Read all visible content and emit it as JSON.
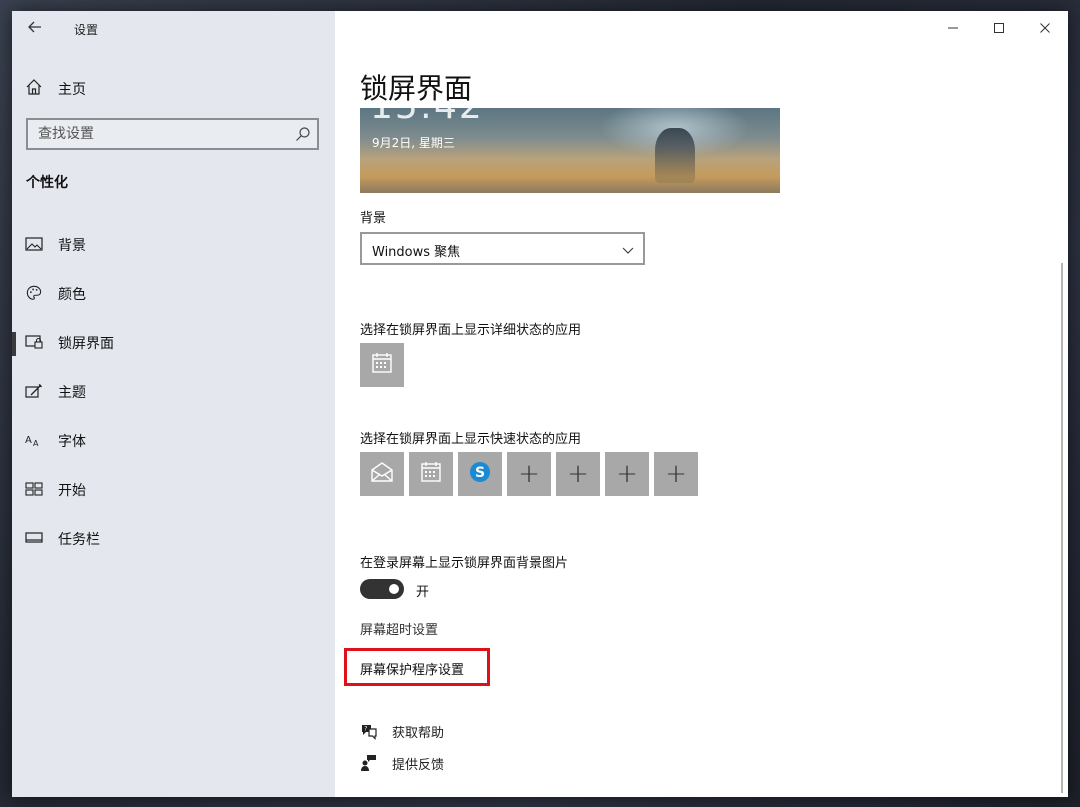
{
  "window": {
    "app_title": "设置",
    "back_icon": "arrow-left-icon",
    "controls": {
      "minimize": "—",
      "maximize": "☐",
      "close": "✕"
    }
  },
  "sidebar": {
    "home_label": "主页",
    "search_placeholder": "查找设置",
    "section_title": "个性化",
    "items": [
      {
        "label": "背景",
        "icon": "picture-icon",
        "active": false
      },
      {
        "label": "颜色",
        "icon": "palette-icon",
        "active": false
      },
      {
        "label": "锁屏界面",
        "icon": "lock-screen-icon",
        "active": true
      },
      {
        "label": "主题",
        "icon": "theme-brush-icon",
        "active": false
      },
      {
        "label": "字体",
        "icon": "font-icon",
        "active": false
      },
      {
        "label": "开始",
        "icon": "start-grid-icon",
        "active": false
      },
      {
        "label": "任务栏",
        "icon": "taskbar-icon",
        "active": false
      }
    ]
  },
  "main": {
    "title": "锁屏界面",
    "preview": {
      "time": "15:42",
      "date": "9月2日, 星期三"
    },
    "background_label": "背景",
    "background_value": "Windows 聚焦",
    "detailed_status_label": "选择在锁屏界面上显示详细状态的应用",
    "quick_status_label": "选择在锁屏界面上显示快速状态的应用",
    "quick_tiles": [
      "mail-icon",
      "calendar-icon",
      "skype-icon",
      "+",
      "+",
      "+",
      "+"
    ],
    "signin_bg_label": "在登录屏幕上显示锁屏界面背景图片",
    "toggle_state": "开",
    "screen_timeout_link": "屏幕超时设置",
    "screensaver_link": "屏幕保护程序设置",
    "help_link": "获取帮助",
    "feedback_link": "提供反馈",
    "highlight_color": "#e0101a"
  }
}
